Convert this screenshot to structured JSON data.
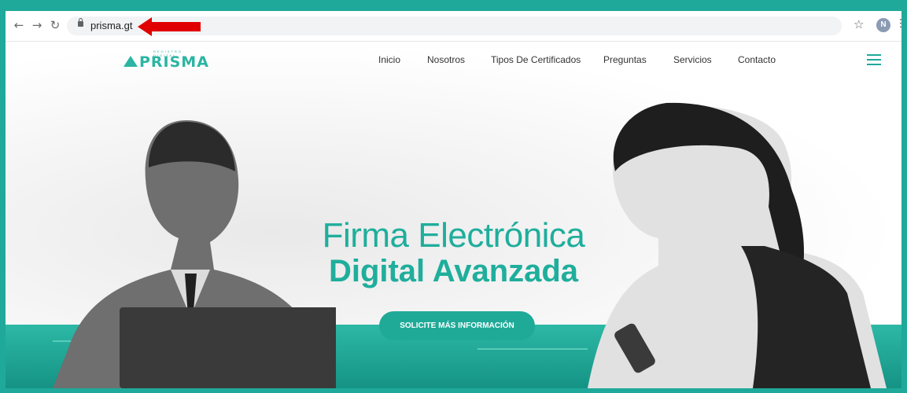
{
  "browser": {
    "url": "prisma.gt"
  },
  "site": {
    "logo_text": "PRISMA",
    "logo_sub": "REGISTRO DIGITAL",
    "nav": [
      "Inicio",
      "Nosotros",
      "Tipos De Certificados",
      "Preguntas",
      "Servicios",
      "Contacto"
    ],
    "hero_line1": "Firma Electrónica",
    "hero_line2": "Digital Avanzada",
    "cta_label": "SOLICITE MÁS INFORMACIÓN"
  },
  "colors": {
    "accent": "#1fae9c",
    "frame": "#1fa99a",
    "annotation_arrow": "#e10000"
  },
  "icons": [
    "back-icon",
    "forward-icon",
    "reload-icon",
    "lock-icon",
    "star-icon",
    "profile-avatar",
    "kebab-menu-icon",
    "hamburger-menu-icon",
    "annotation-arrow"
  ]
}
